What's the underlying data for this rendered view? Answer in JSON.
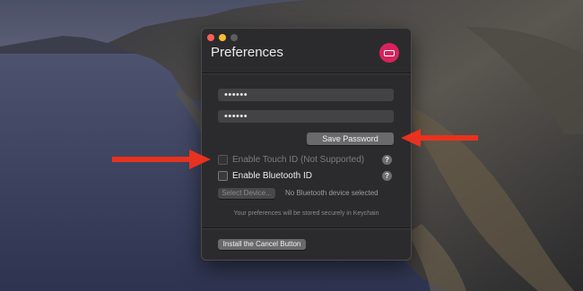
{
  "window": {
    "title": "Preferences",
    "icon": "lock-badge-icon"
  },
  "password": {
    "field1_value": "••••••",
    "field2_value": "••••••",
    "save_label": "Save Password"
  },
  "options": {
    "touch_id_label": "Enable Touch ID (Not Supported)",
    "touch_id_checked": false,
    "bluetooth_label": "Enable Bluetooth ID",
    "bluetooth_checked": false,
    "help_glyph": "?"
  },
  "bluetooth": {
    "select_device_label": "Select Device...",
    "status_text": "No Bluetooth device selected"
  },
  "note": "Your preferences will be stored securely in Keychain",
  "footer": {
    "install_label": "Install the Cancel Button"
  },
  "colors": {
    "accent": "#d6235d",
    "arrow": "#e8321f"
  }
}
